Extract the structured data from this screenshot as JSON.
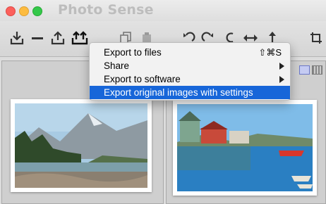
{
  "window": {
    "title": "Photo Sense"
  },
  "toolbar": {
    "icons": [
      "import-icon",
      "remove-icon",
      "export-icon",
      "export-multiple-icon",
      "copy-icon",
      "paste-icon",
      "rotate-left-icon",
      "rotate-right-icon",
      "undo-icon",
      "flip-horizontal-icon",
      "flip-vertical-icon",
      "crop-icon"
    ]
  },
  "menu": {
    "items": [
      {
        "label": "Export to files",
        "shortcut": "⇧⌘S",
        "submenu": false,
        "selected": false
      },
      {
        "label": "Share",
        "shortcut": "",
        "submenu": true,
        "selected": false
      },
      {
        "label": "Export to software",
        "shortcut": "",
        "submenu": true,
        "selected": false
      },
      {
        "label": "Export original images with settings",
        "shortcut": "",
        "submenu": false,
        "selected": true
      }
    ]
  },
  "colors": {
    "selection": "#1766d9",
    "title_gray": "#bdbdbd",
    "close": "#fc605c",
    "minimize": "#fdbc40",
    "maximize": "#34c84a"
  }
}
